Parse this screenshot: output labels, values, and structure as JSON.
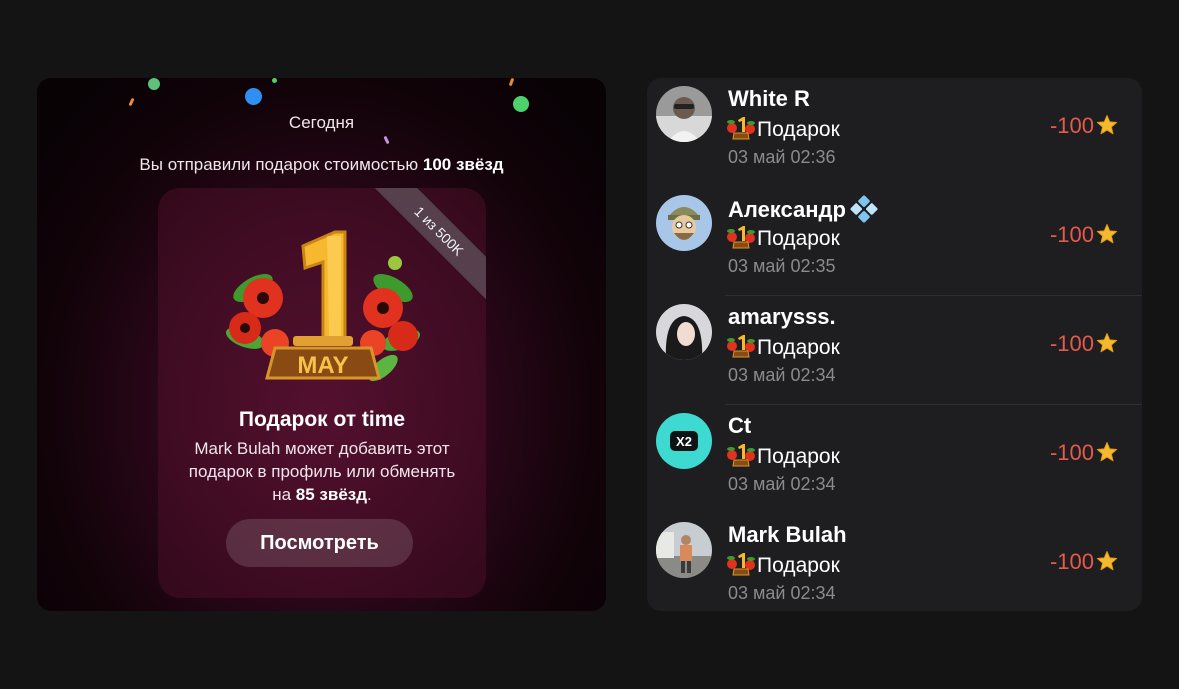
{
  "gift_card": {
    "date_label": "Сегодня",
    "sent_text_prefix": "Вы отправили подарок стоимостью ",
    "sent_text_value": "100 звёзд",
    "ribbon": "1 из 500K",
    "art_caption": "MAY",
    "art_number": "1",
    "gift_title": "Подарок от time",
    "desc_prefix": "Mark Bulah может добавить этот подарок в профиль или обменять на ",
    "desc_value": "85 звёзд",
    "desc_suffix": ".",
    "view_button": "Посмотреть"
  },
  "transactions": [
    {
      "name": "White R",
      "verified": false,
      "gift": "Подарок",
      "date": "03 май 02:36",
      "amount": "-100",
      "avatar": "photo-dark"
    },
    {
      "name": "Александр",
      "verified": true,
      "gift": "Подарок",
      "date": "03 май 02:35",
      "amount": "-100",
      "avatar": "cartoon"
    },
    {
      "name": "amarysss.",
      "verified": false,
      "gift": "Подарок",
      "date": "03 май 02:34",
      "amount": "-100",
      "avatar": "photo-girl"
    },
    {
      "name": "Ct",
      "verified": false,
      "gift": "Подарок",
      "date": "03 май 02:34",
      "amount": "-100",
      "avatar": "x2-logo",
      "avatar_text": "X2"
    },
    {
      "name": "Mark Bulah",
      "verified": false,
      "gift": "Подарок",
      "date": "03 май 02:34",
      "amount": "-100",
      "avatar": "photo-outdoor"
    }
  ],
  "colors": {
    "amount": "#e45a4c",
    "star": "#f5b82e",
    "card_accent": "#4a0e2c",
    "list_bg": "#1e1e20"
  },
  "icons": [
    "star-icon",
    "verified-icon",
    "may-gift-icon"
  ]
}
